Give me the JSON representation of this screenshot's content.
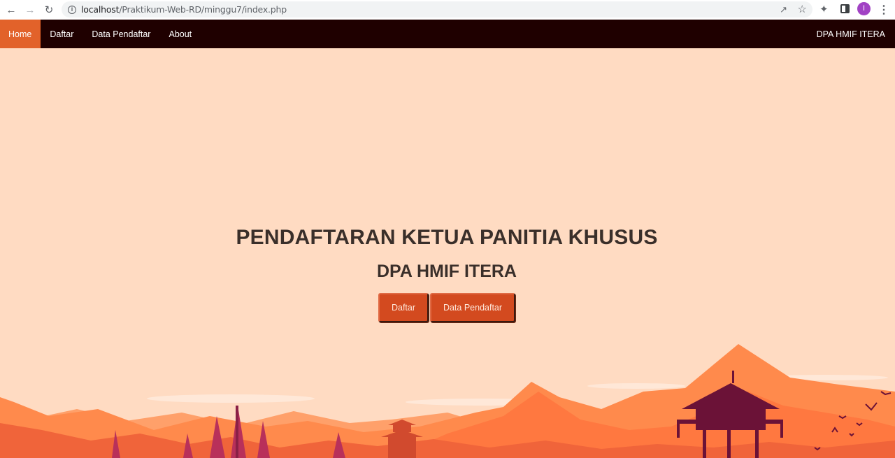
{
  "browser": {
    "url_host": "localhost",
    "url_path": "/Praktikum-Web-RD/minggu7/index.php",
    "profile_initial": "I",
    "icons": [
      "back-icon",
      "forward-icon",
      "reload-icon",
      "info-icon",
      "share-icon",
      "star-icon",
      "extensions-icon",
      "side-panel-icon",
      "menu-icon"
    ]
  },
  "navbar": {
    "items": [
      {
        "label": "Home",
        "active": true
      },
      {
        "label": "Daftar"
      },
      {
        "label": "Data Pendaftar"
      },
      {
        "label": "About"
      }
    ],
    "brand": "DPA HMIF ITERA"
  },
  "hero": {
    "title": "PENDAFTARAN KETUA PANITIA KHUSUS",
    "subtitle": "DPA HMIF ITERA",
    "buttons": {
      "daftar": "Daftar",
      "data_pendaftar": "Data Pendaftar"
    }
  },
  "colors": {
    "navbar_bg": "#1f0000",
    "active_tab": "#e2622a",
    "page_bg": "#ffdbc2",
    "button_bg": "#d34a1f"
  }
}
